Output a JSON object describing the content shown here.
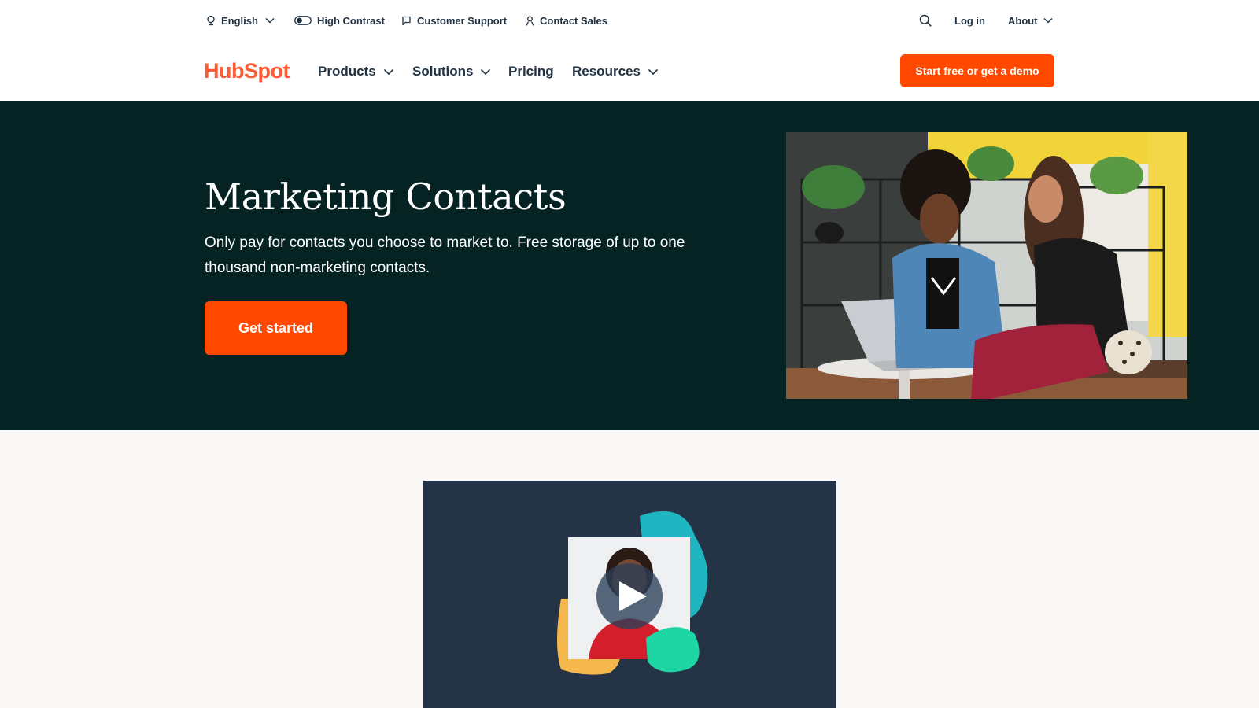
{
  "utility_bar": {
    "language": "English",
    "high_contrast": "High Contrast",
    "customer_support": "Customer Support",
    "contact_sales": "Contact Sales",
    "login": "Log in",
    "about": "About"
  },
  "brand": {
    "logo_text": "HubSpot",
    "accent_color": "#ff4800",
    "logo_color": "#ff5c35"
  },
  "main_nav": {
    "items": [
      "Products",
      "Solutions",
      "Pricing",
      "Resources"
    ],
    "cta": "Start free or get a demo"
  },
  "hero": {
    "title": "Marketing Contacts",
    "description": "Only pay for contacts you choose to market to. Free storage of up to one thousand non-marketing contacts.",
    "button": "Get started",
    "background": "#062323"
  },
  "video": {
    "background": "#243345",
    "icon": "play-icon"
  }
}
